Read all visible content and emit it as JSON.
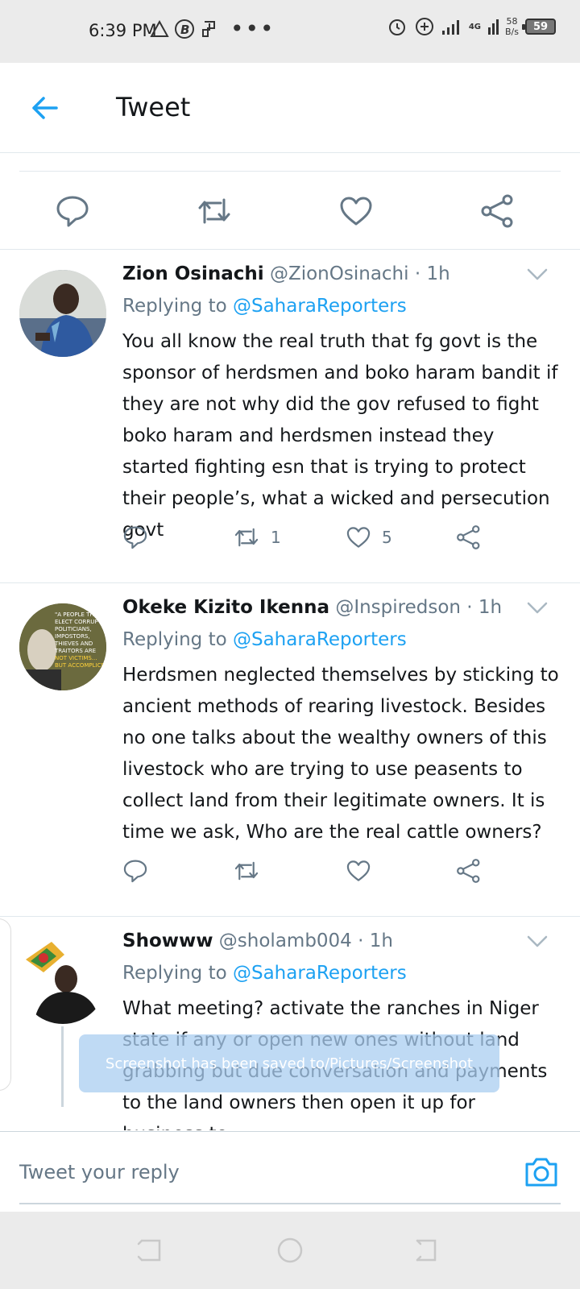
{
  "status_bar": {
    "time": "6:39 PM",
    "net_speed_value": "58",
    "net_speed_unit": "B/s",
    "network_type": "4G",
    "battery": "59"
  },
  "header": {
    "title": "Tweet"
  },
  "colors": {
    "accent": "#1da1f2",
    "text": "#14171a",
    "secondary": "#657786",
    "divider": "#e1e8ed"
  },
  "replies": [
    {
      "name": "Zion Osinachi",
      "handle": "@ZionOsinachi",
      "time": "· 1h",
      "replying_prefix": "Replying to",
      "replying_to": "@SaharaReporters",
      "text": "You all know the real truth that fg govt is the sponsor of herdsmen and boko haram bandit if they are not why did the gov refused to fight boko haram and herdsmen instead they started fighting esn that is trying to protect their people’s, what a wicked and persecution govt",
      "retweets": "1",
      "likes": "5"
    },
    {
      "name": "Okeke Kizito Ikenna",
      "handle": "@Inspiredson",
      "time": "· 1h",
      "replying_prefix": "Replying to",
      "replying_to": "@SaharaReporters",
      "text": "Herdsmen neglected themselves by sticking to ancient methods of rearing livestock. Besides no one talks about the wealthy owners of this livestock who are trying to use peasents to collect land from their legitimate owners. It is time we ask, Who are the real cattle owners?",
      "retweets": "",
      "likes": "",
      "avatar_text": "\"A PEOPLE THAT ELECT CORRUPT POLITICIANS, IMPOSTORS, THIEVES AND TRAITORS ARE NOT VICTIMS... BUT ACCOMPLICES\""
    },
    {
      "name": "Showww",
      "handle": "@sholamb004",
      "time": "· 1h",
      "replying_prefix": "Replying to",
      "replying_to": "@SaharaReporters",
      "text": "What meeting? activate the ranches in Niger state if any or open new ones without land grabbing but due conversation and payments to the land owners then open it up for business to"
    }
  ],
  "toast": {
    "message": "Screenshot has been saved to/Pictures/Screenshot"
  },
  "composer": {
    "placeholder": "Tweet your reply"
  }
}
